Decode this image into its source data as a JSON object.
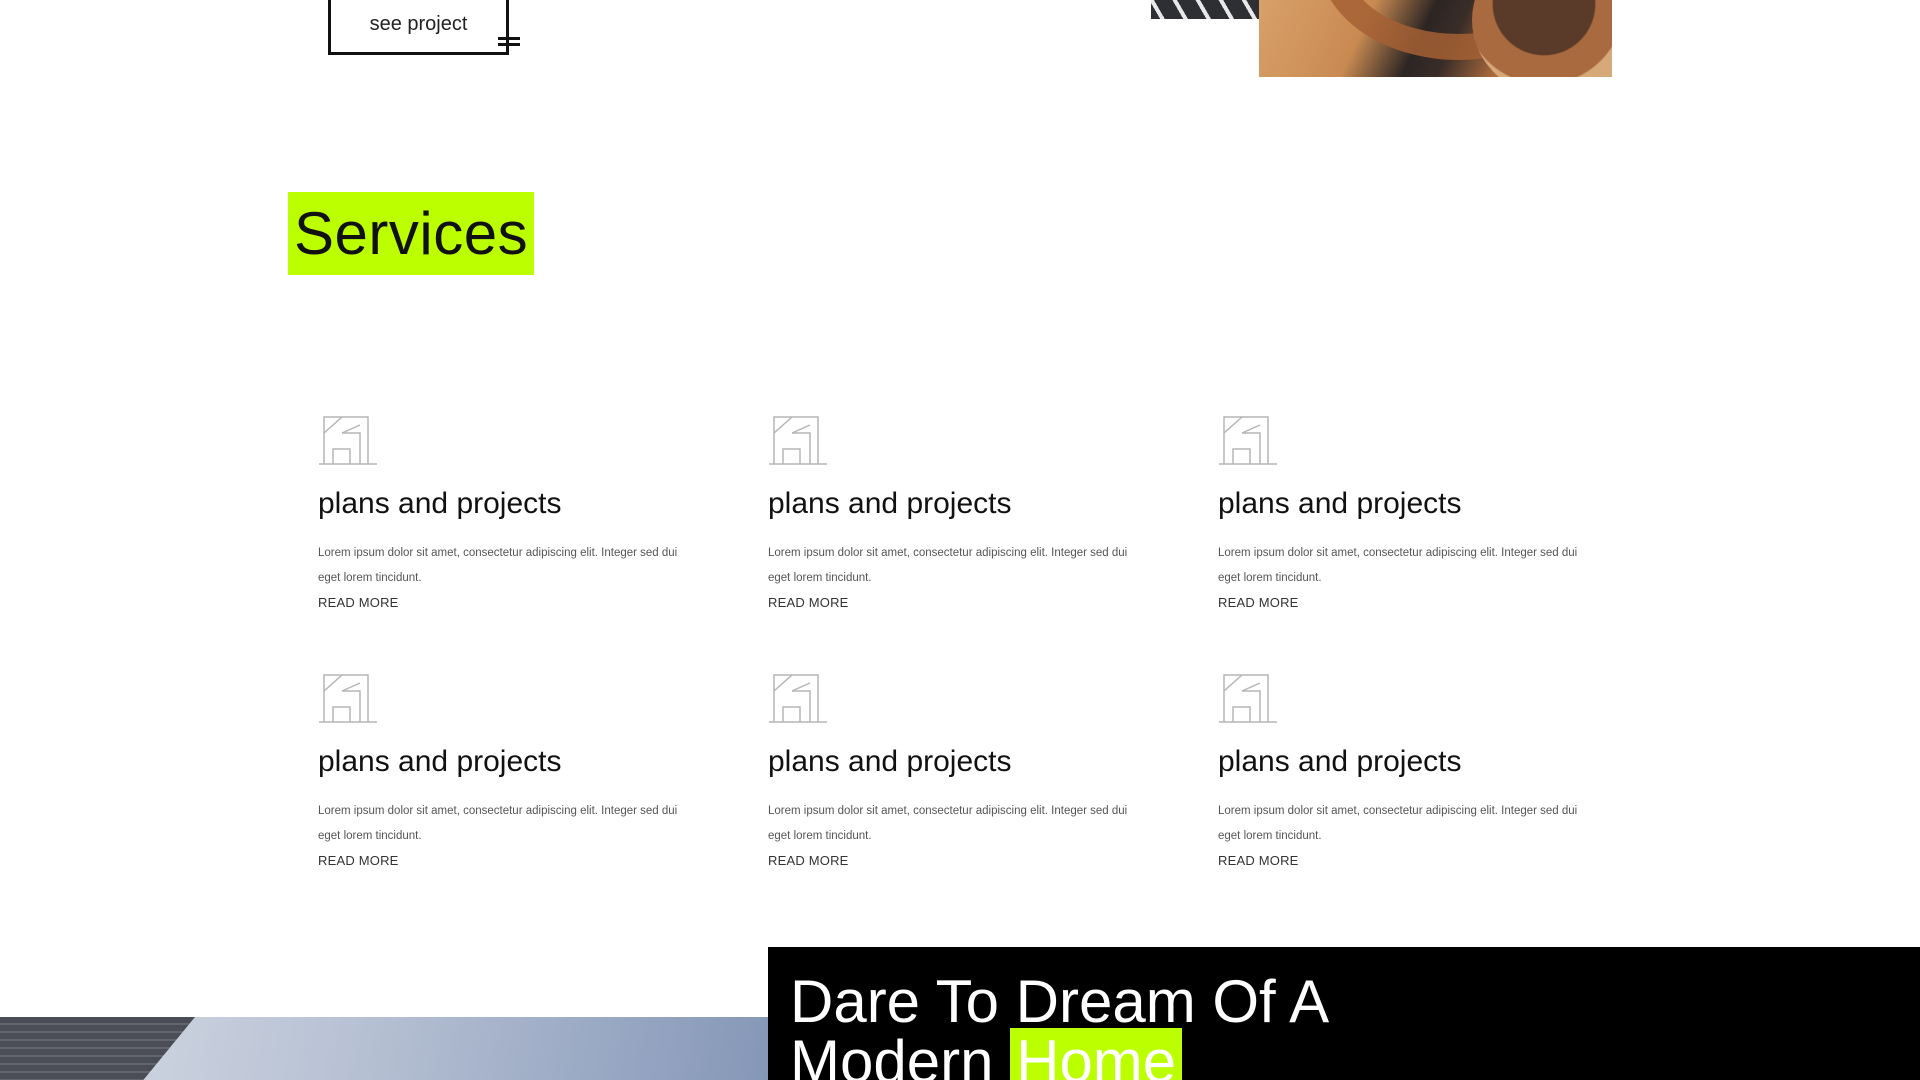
{
  "hero": {
    "see_project_label": "see project"
  },
  "services": {
    "heading": "Services",
    "items": [
      {
        "title": "plans and projects",
        "description": "Lorem ipsum dolor sit amet, consectetur adipiscing elit. Integer sed dui eget lorem tincidunt.",
        "link": "READ MORE",
        "icon": "floor-plan-icon"
      },
      {
        "title": "plans and projects",
        "description": "Lorem ipsum dolor sit amet, consectetur adipiscing elit. Integer sed dui eget lorem tincidunt.",
        "link": "READ MORE",
        "icon": "floor-plan-icon"
      },
      {
        "title": "plans and projects",
        "description": "Lorem ipsum dolor sit amet, consectetur adipiscing elit. Integer sed dui eget lorem tincidunt.",
        "link": "READ MORE",
        "icon": "floor-plan-icon"
      },
      {
        "title": "plans and projects",
        "description": "Lorem ipsum dolor sit amet, consectetur adipiscing elit. Integer sed dui eget lorem tincidunt.",
        "link": "READ MORE",
        "icon": "floor-plan-icon"
      },
      {
        "title": "plans and projects",
        "description": "Lorem ipsum dolor sit amet, consectetur adipiscing elit. Integer sed dui eget lorem tincidunt.",
        "link": "READ MORE",
        "icon": "floor-plan-icon"
      },
      {
        "title": "plans and projects",
        "description": "Lorem ipsum dolor sit amet, consectetur adipiscing elit. Integer sed dui eget lorem tincidunt.",
        "link": "READ MORE",
        "icon": "floor-plan-icon"
      }
    ]
  },
  "dream": {
    "line1": "Dare To Dream Of A",
    "line2_prefix": "Modern",
    "line2_highlight": "Home"
  },
  "colors": {
    "accent": "#bbff00",
    "dark": "#000000",
    "text": "#111111"
  }
}
